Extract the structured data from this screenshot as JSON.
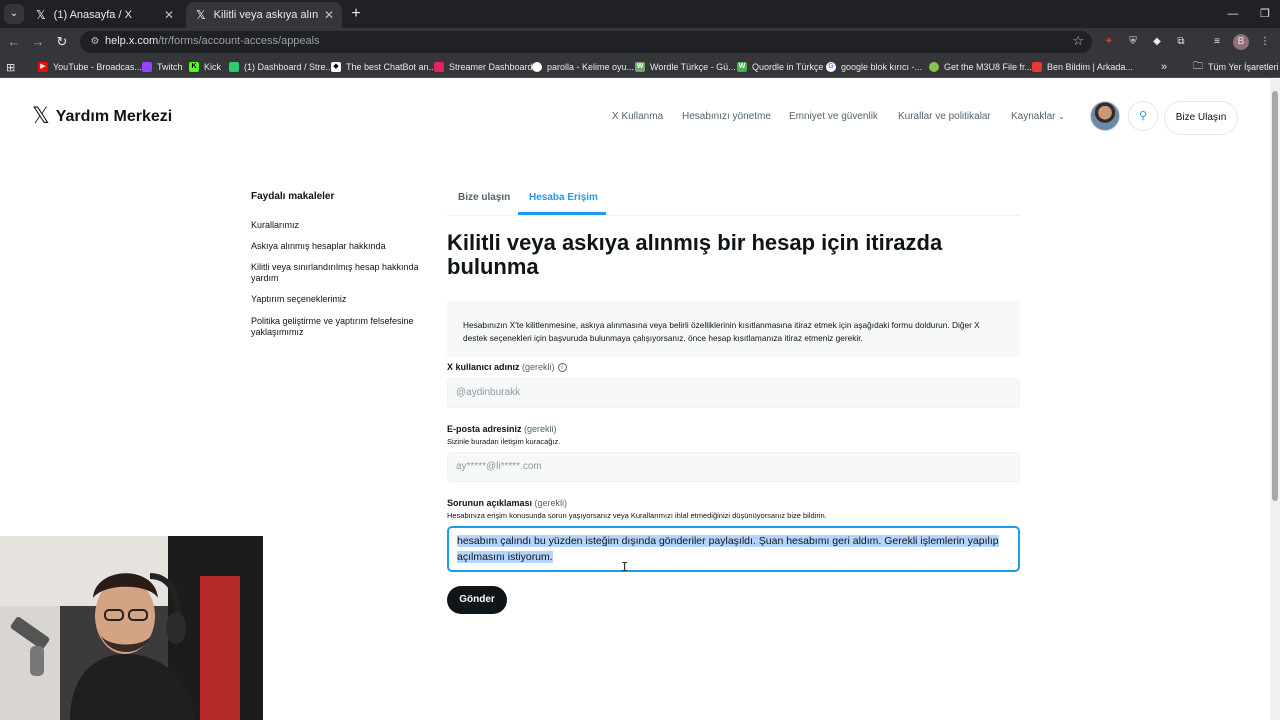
{
  "browser": {
    "tabs": [
      {
        "label": "(1) Anasayfa / X",
        "active": false
      },
      {
        "label": "Kilitli veya askıya alınmış bir he…",
        "active": true
      }
    ],
    "url_host": "help.x.com",
    "url_path": "/tr/forms/account-access/appeals",
    "profile_initial": "B",
    "bookmarks": [
      {
        "label": "YouTube - Broadcas...",
        "color": "#ff0000"
      },
      {
        "label": "Twitch",
        "color": "#9146ff"
      },
      {
        "label": "Kick",
        "color": "#53fc18"
      },
      {
        "label": "(1) Dashboard / Stre...",
        "color": "#2ecc71"
      },
      {
        "label": "The best ChatBot an...",
        "color": "#ffffff"
      },
      {
        "label": "Streamer Dashboard",
        "color": "#e91e63"
      },
      {
        "label": "parolla - Kelime oyu...",
        "color": "#ffffff"
      },
      {
        "label": "Wordle Türkçe - Gü...",
        "color": "#6aaa64"
      },
      {
        "label": "Quordle in Türkçe",
        "color": "#4caf50"
      },
      {
        "label": "google blok kırıcı -...",
        "color": "#4285f4"
      },
      {
        "label": "Get the M3U8 File fr...",
        "color": "#8bc34a"
      },
      {
        "label": "Ben Bildim | Arkada...",
        "color": "#e53935"
      }
    ],
    "all_bookmarks_label": "Tüm Yer İşaretleri"
  },
  "header": {
    "brand": "Yardım Merkezi",
    "nav": [
      "X Kullanma",
      "Hesabınızı yönetme",
      "Emniyet ve güvenlik",
      "Kurallar ve politikalar",
      "Kaynaklar"
    ],
    "contact_button": "Bize Ulaşın"
  },
  "sidebar": {
    "heading": "Faydalı makaleler",
    "links": [
      "Kurallarımız",
      "Askıya alınmış hesaplar hakkında",
      "Kilitli veya sınırlandırılmış hesap hakkında yardım",
      "Yaptırım seçeneklerimiz",
      "Politika geliştirme ve yaptırım felsefesine yaklaşımımız"
    ]
  },
  "content": {
    "tabs": [
      {
        "label": "Bize ulaşın",
        "active": false
      },
      {
        "label": "Hesaba Erişim",
        "active": true
      }
    ],
    "title": "Kilitli veya askıya alınmış bir hesap için itirazda bulunma",
    "info": "Hesabınızın X'te kilitlenmesine, askıya alınmasına veya belirli özelliklerinin kısıtlanmasına itiraz etmek için aşağıdaki formu doldurun. Diğer X destek seçenekleri için başvuruda bulunmaya çalışıyorsanız, önce hesap kısıtlamanıza itiraz etmeniz gerekir.",
    "fields": {
      "username": {
        "label": "X kullanıcı adınız",
        "required": "(gerekli)",
        "value": "@aydinburakk"
      },
      "email": {
        "label": "E-posta adresiniz",
        "required": "(gerekli)",
        "help": "Sizinle buradan iletişim kuracağız.",
        "value": "ay*****@li*****.com"
      },
      "description": {
        "label": "Sorunun açıklaması",
        "required": "(gerekli)",
        "help": "Hesabınıza erişim konusunda sorun yaşıyorsanız veya Kurallarımızı ihlal etmediğinizi düşünüyorsanız bize bildirin.",
        "value": "hesabım çalındı bu yüzden isteğim dışında gönderiler paylaşıldı. Şuan hesabımı geri aldım. Gerekli işlemlerin yapılıp açılmasını istiyorum."
      }
    },
    "submit": "Gönder"
  },
  "colors": {
    "accent": "#1d9bf0",
    "text": "#0f1419",
    "muted": "#536471",
    "button": "#0f1419"
  }
}
